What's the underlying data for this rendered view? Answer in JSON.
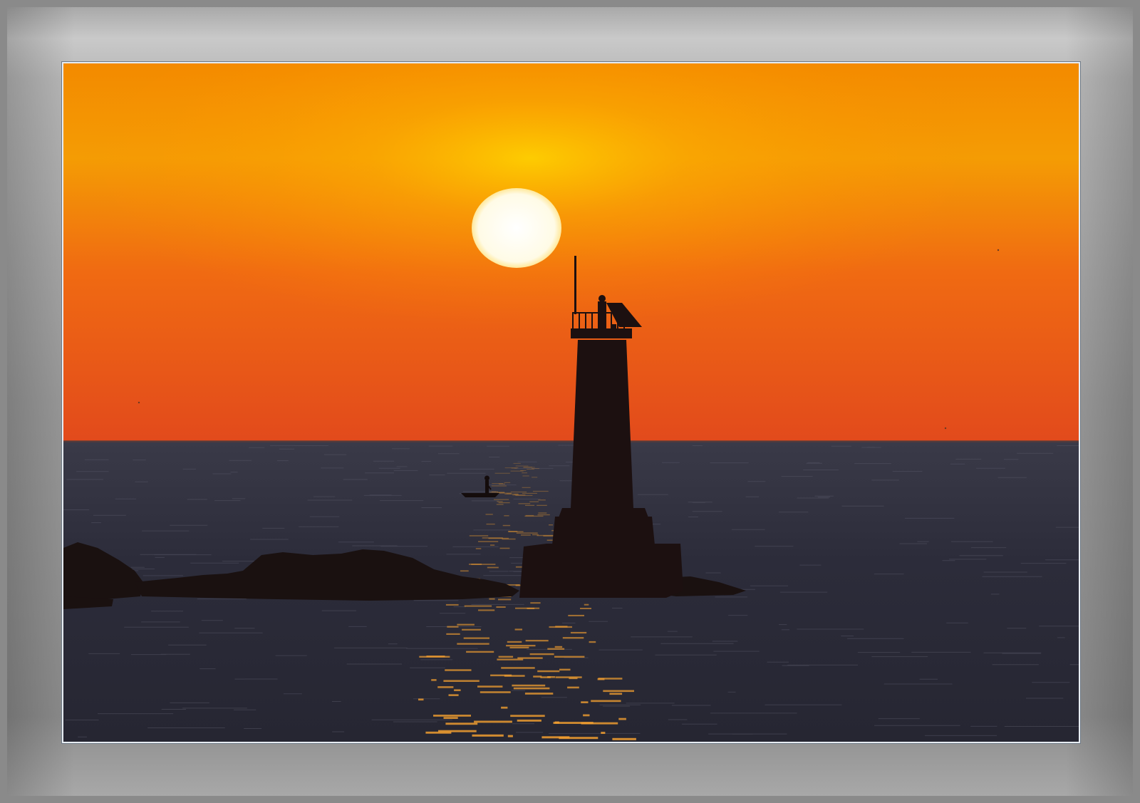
{
  "image": {
    "subject": "lighthouse-at-sunrise",
    "elements": [
      "sun",
      "lighthouse",
      "fishing-boat",
      "rocks",
      "sea",
      "sky"
    ]
  },
  "colors": {
    "frame_gray": "#9a9a9a",
    "sky_top": "#f49a00",
    "sky_mid": "#f26a10",
    "sky_horizon": "#e6481a",
    "sun": "#fffdf0",
    "sea": "#2a2a36",
    "silhouette": "#1a0f0e",
    "glitter": "#f4a030"
  }
}
